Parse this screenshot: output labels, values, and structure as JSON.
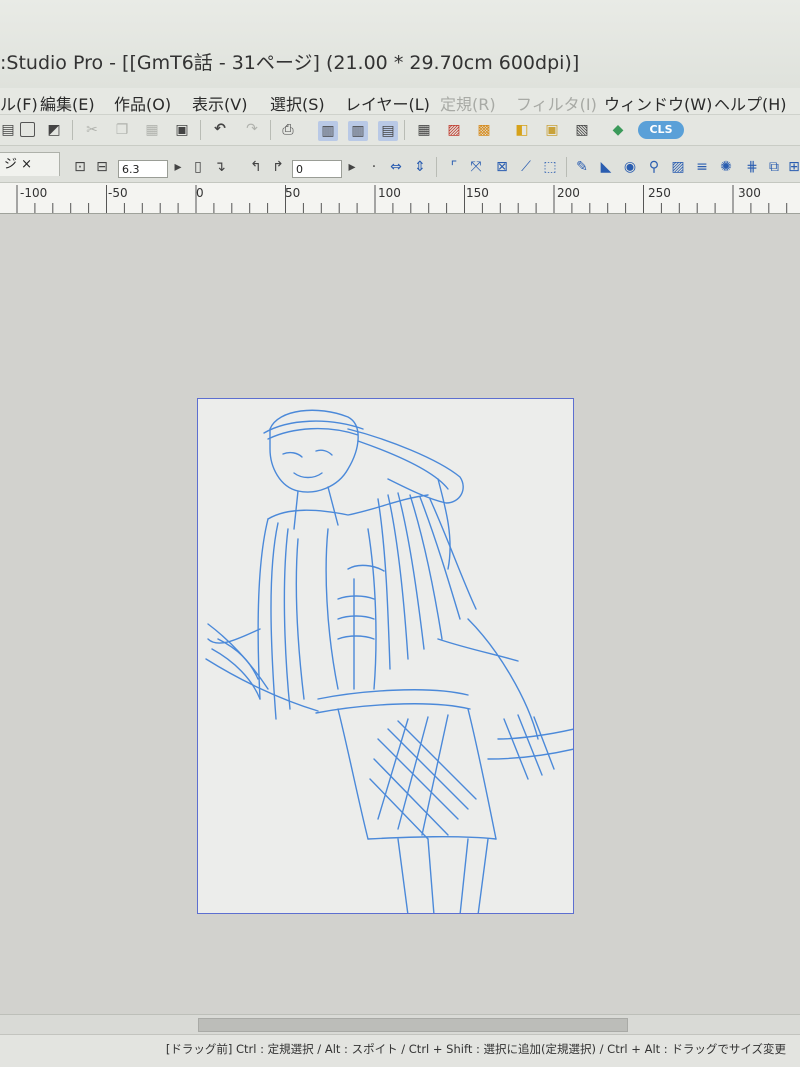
{
  "window": {
    "title": ":Studio Pro - [[GmT6話 - 31ページ] (21.00 * 29.70cm 600dpi)]"
  },
  "menu": [
    {
      "label": "ル(F)",
      "state": "normal"
    },
    {
      "label": "編集(E)",
      "state": "normal"
    },
    {
      "label": "作品(O)",
      "state": "normal"
    },
    {
      "label": "表示(V)",
      "state": "normal"
    },
    {
      "label": "選択(S)",
      "state": "normal"
    },
    {
      "label": "レイヤー(L)",
      "state": "normal"
    },
    {
      "label": "定規(R)",
      "state": "dim"
    },
    {
      "label": "フィルタ(I)",
      "state": "dim"
    },
    {
      "label": "ウィンドウ(W)",
      "state": "normal"
    },
    {
      "label": "ヘルプ(H)",
      "state": "normal"
    }
  ],
  "toolbar1": {
    "icons": [
      "open-icon",
      "save-icon",
      "save-as-icon",
      "cut-icon",
      "copy-icon",
      "paste-icon",
      "delete-icon",
      "undo-icon",
      "redo-icon",
      "print-icon",
      "page-view-icon",
      "spread-view-icon",
      "page-manage-icon",
      "layer-icon",
      "ruler-icon",
      "palette-icon",
      "folder-icon",
      "settings-icon",
      "export-icon",
      "link-icon"
    ],
    "badge": "CLS",
    "colors": {
      "badge": "#5aa0d8",
      "accent": "#3b6fb6"
    }
  },
  "toolbar2": {
    "doc_tab": "ジ ×",
    "brush_size": "6.3",
    "angle": "0"
  },
  "ruler": {
    "labels": [
      "-100",
      "-50",
      "0",
      "50",
      "100",
      "150",
      "200",
      "250",
      "300"
    ]
  },
  "status": {
    "hint": "[ドラッグ前] Ctrl : 定規選択 / Alt : スポイト / Ctrl + Shift : 選択に追加(定規選択) / Ctrl + Alt : ドラッグでサイズ変更"
  },
  "canvas": {
    "sketch_color": "#2f78d6"
  }
}
